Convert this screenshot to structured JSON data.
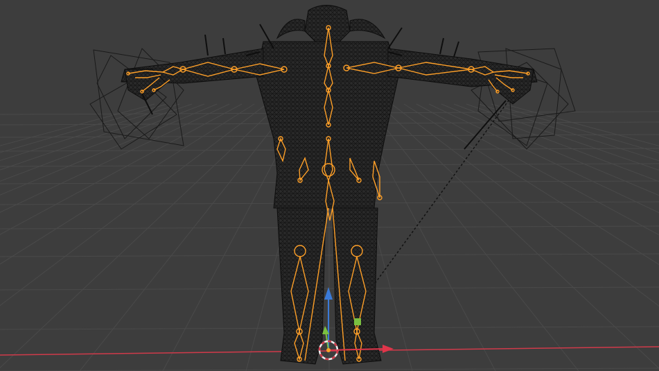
{
  "viewport": {
    "name": "3D Viewport",
    "background": "#3d3d3d",
    "grid_color": "#4a4a4a",
    "x_axis_color": "#d03a4a",
    "y_axis_color": "#7aa83a",
    "mesh_wire_color": "#111111",
    "armature_color": "#ffa028",
    "gizmo_up_color": "#3a7ad8",
    "gizmo_forward_color": "#7ac040",
    "gizmo_right_color": "#e0354a",
    "cursor_icon": "3d-cursor-icon",
    "mode": "wireframe",
    "object": "character-mesh-with-armature"
  }
}
